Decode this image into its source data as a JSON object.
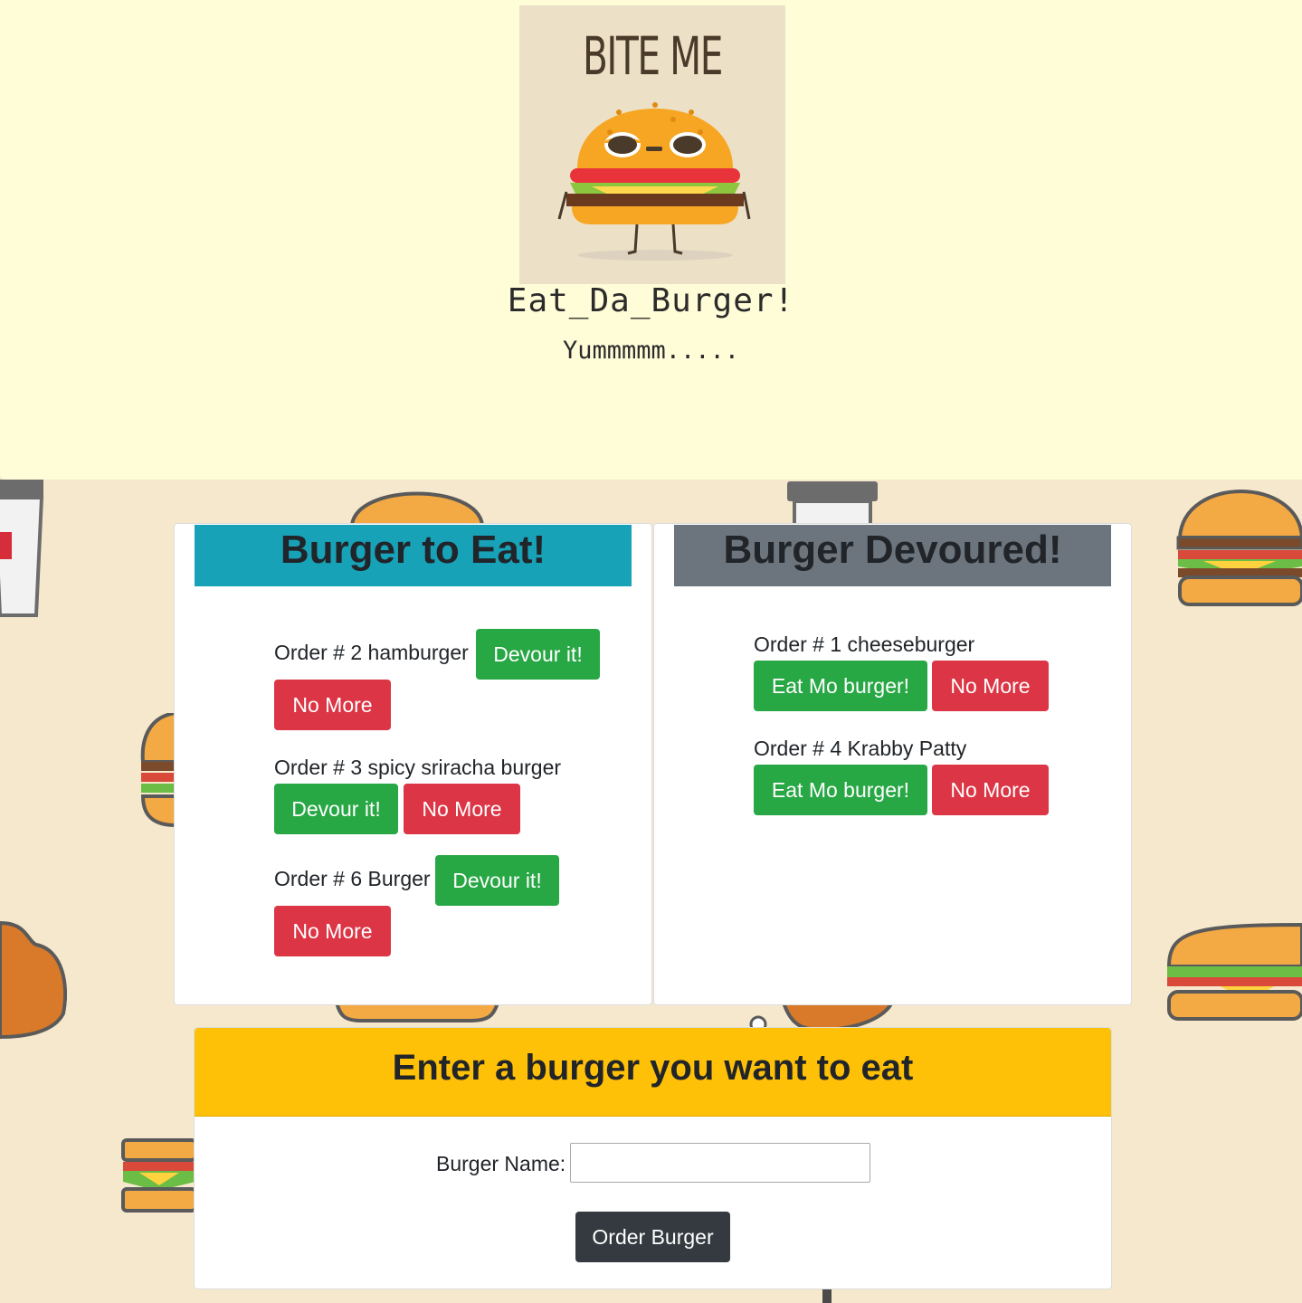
{
  "header": {
    "logo_text": "BITE ME",
    "title": "Eat_Da_Burger!",
    "tagline": "Yummmmm....."
  },
  "to_eat": {
    "heading": "Burger to Eat!",
    "header_color": "#17a2b8",
    "items": [
      {
        "label": "Order # 2 hamburger",
        "devour_label": "Devour it!",
        "remove_label": "No More"
      },
      {
        "label": "Order # 3 spicy sriracha burger",
        "devour_label": "Devour it!",
        "remove_label": "No More"
      },
      {
        "label": "Order # 6 Burger",
        "devour_label": "Devour it!",
        "remove_label": "No More"
      }
    ]
  },
  "devoured": {
    "heading": "Burger Devoured!",
    "header_color": "#6c757d",
    "items": [
      {
        "label": "Order # 1 cheeseburger",
        "again_label": "Eat Mo burger!",
        "remove_label": "No More"
      },
      {
        "label": "Order # 4 Krabby Patty",
        "again_label": "Eat Mo burger!",
        "remove_label": "No More"
      }
    ]
  },
  "order_form": {
    "heading": "Enter a burger you want to eat",
    "header_color": "#ffc107",
    "label": "Burger Name:",
    "input_value": "",
    "submit_label": "Order Burger"
  },
  "colors": {
    "success": "#28a745",
    "danger": "#dc3545",
    "dark": "#343a40",
    "page_bg": "#f6e8cc",
    "jumbotron_bg": "#fffdd8"
  }
}
